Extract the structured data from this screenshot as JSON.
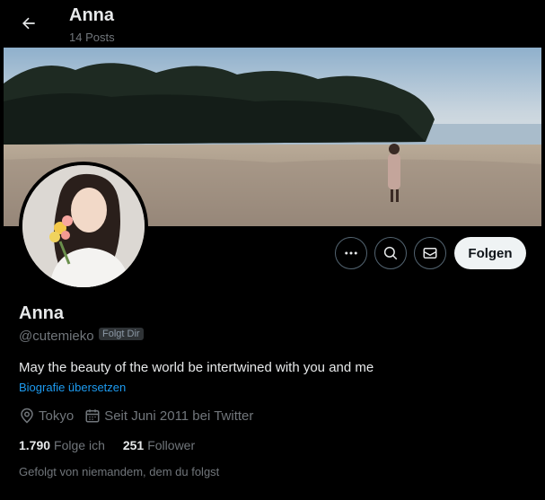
{
  "header": {
    "title": "Anna",
    "posts": "14 Posts"
  },
  "actions": {
    "follow_label": "Folgen"
  },
  "profile": {
    "name": "Anna",
    "handle": "@cutemieko",
    "follows_you_badge": "Folgt Dir",
    "bio": "May the beauty of the world be intertwined with you and me",
    "translate_bio": "Biografie übersetzen",
    "location": "Tokyo",
    "joined": "Seit Juni 2011 bei Twitter",
    "following_count": "1.790",
    "following_label": "Folge ich",
    "followers_count": "251",
    "followers_label": "Follower",
    "followed_by": "Gefolgt von niemandem, dem du folgst"
  },
  "icons": [
    "back-arrow-icon",
    "more-icon",
    "search-icon",
    "mail-icon",
    "location-icon",
    "calendar-icon"
  ],
  "colors": {
    "background": "#000000",
    "text": "#e7e9ea",
    "muted": "#71767b",
    "link": "#1d9bf0",
    "follow_button": "#eff3f4"
  }
}
